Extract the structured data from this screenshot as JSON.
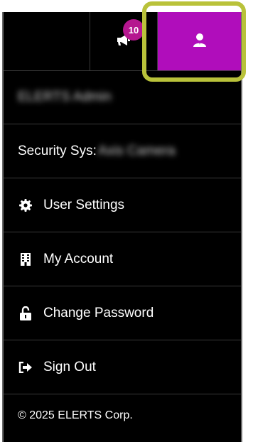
{
  "topbar": {
    "announcements_badge": "10",
    "announcements_icon": "megaphone-icon",
    "user_icon": "user-icon",
    "user_button_color": "#b00dbb",
    "highlight_color": "#b9c23a"
  },
  "menu": {
    "user_name": "ELERTS Admin",
    "security_label": "Security Sys:",
    "security_value": "Axis Camera",
    "items": [
      {
        "label": "User Settings",
        "icon": "gear-icon"
      },
      {
        "label": "My Account",
        "icon": "building-icon"
      },
      {
        "label": "Change Password",
        "icon": "unlock-icon"
      },
      {
        "label": "Sign Out",
        "icon": "sign-out-icon"
      }
    ]
  },
  "footer": {
    "copyright": "© 2025 ELERTS Corp."
  }
}
